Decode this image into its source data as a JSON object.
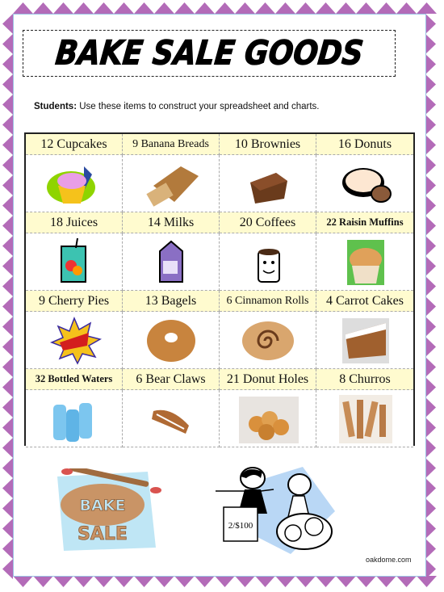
{
  "title": "BAKE SALE GOODS",
  "intro": {
    "label": "Students:",
    "text": " Use these items  to construct your spreadsheet and charts."
  },
  "items": [
    {
      "label": "12 Cupcakes",
      "icon": "cupcake-icon"
    },
    {
      "label": "9 Banana Breads",
      "icon": "banana-bread-icon"
    },
    {
      "label": "10 Brownies",
      "icon": "brownie-icon"
    },
    {
      "label": "16 Donuts",
      "icon": "donut-icon"
    },
    {
      "label": "18 Juices",
      "icon": "juice-box-icon"
    },
    {
      "label": "14 Milks",
      "icon": "milk-carton-icon"
    },
    {
      "label": "20 Coffees",
      "icon": "coffee-cup-icon"
    },
    {
      "label": "22 Raisin Muffins",
      "icon": "muffin-icon"
    },
    {
      "label": "9 Cherry Pies",
      "icon": "cherry-pie-icon"
    },
    {
      "label": "13 Bagels",
      "icon": "bagel-icon"
    },
    {
      "label": "6 Cinnamon Rolls",
      "icon": "cinnamon-roll-icon"
    },
    {
      "label": "4 Carrot Cakes",
      "icon": "carrot-cake-icon"
    },
    {
      "label": "32 Bottled Waters",
      "icon": "water-bottles-icon"
    },
    {
      "label": "6 Bear Claws",
      "icon": "bear-claw-icon"
    },
    {
      "label": "21 Donut Holes",
      "icon": "donut-holes-icon"
    },
    {
      "label": "8 Churros",
      "icon": "churros-icon"
    }
  ],
  "footer": {
    "bake_sale_sign": {
      "line1": "BAKE",
      "line2": "SALE"
    },
    "price_sign": "2/$100",
    "credit": "oakdome.com"
  },
  "colors": {
    "border": "#b36bb8",
    "label_bg": "#fffbcf"
  }
}
